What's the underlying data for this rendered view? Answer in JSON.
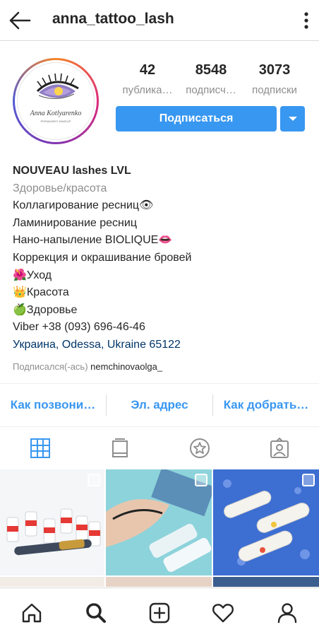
{
  "header": {
    "username": "anna_tattoo_lash",
    "back_icon": "arrow-left-icon",
    "menu_icon": "kebab-icon"
  },
  "profile": {
    "logo_name": "Anna Kotlyarenko",
    "logo_sub": "PERMANENT MAKEUP"
  },
  "stats": [
    {
      "value": "42",
      "label": "публика…"
    },
    {
      "value": "8548",
      "label": "подписч…"
    },
    {
      "value": "3073",
      "label": "подписки"
    }
  ],
  "buttons": {
    "follow": "Подписаться"
  },
  "bio": {
    "name": "NOUVEAU lashes LVL",
    "category": "Здоровье/красота",
    "lines": [
      "Коллагирование ресниц👁",
      "Ламинирование ресниц",
      "Нано-напыление BIOLIQUE👄",
      "Коррекция и окрашивание бровей",
      "🌺Уход",
      "👑Красота",
      "🍏Здоровье",
      "Viber +38 (093) 696-46-46"
    ],
    "location": "Украина, Odessa, Ukraine 65122",
    "followed_prefix": "Подписался(-ась)",
    "followed_user": "nemchinovaolga_"
  },
  "actions": [
    "Как позвони…",
    "Эл. адрес",
    "Как добрать…"
  ],
  "tabs": [
    "grid-icon",
    "igtv-icon",
    "star-icon",
    "tagged-icon"
  ],
  "nav": [
    "home-icon",
    "search-icon",
    "add-icon",
    "heart-icon",
    "profile-icon"
  ],
  "colors": {
    "accent": "#3897f0",
    "text": "#262626",
    "muted": "#8e8e8e",
    "link": "#003569"
  }
}
